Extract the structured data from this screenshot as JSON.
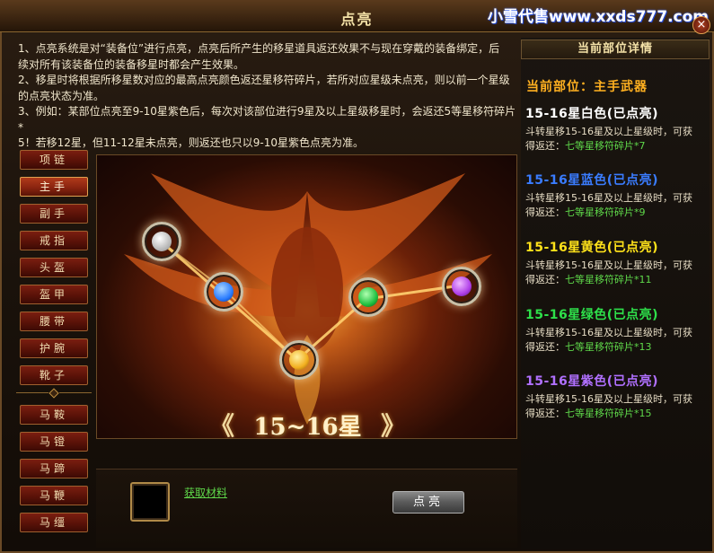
{
  "window": {
    "title": "点亮",
    "watermark": "小雪代售www.xxds777.com",
    "close_glyph": "×"
  },
  "description": [
    "1、点亮系统是对“装备位”进行点亮，点亮后所产生的移星道具返还效果不与现在穿戴的装备绑定，后",
    "续对所有该装备位的装备移星时都会产生效果。",
    "2、移星时将根据所移星数对应的最高点亮颜色返还星移符碎片，若所对应星级未点亮，则以前一个星级",
    "的点亮状态为准。",
    "3、例如：某部位点亮至9-10星紫色后，每次对该部位进行9星及以上星级移星时，会返还5等星移符碎片*",
    "5！若移12星，但11-12星未点亮，则返还也只以9-10星紫色点亮为准。"
  ],
  "nav": {
    "items": [
      {
        "label": "项链",
        "active": false
      },
      {
        "label": "主手",
        "active": true
      },
      {
        "label": "副手",
        "active": false
      },
      {
        "label": "戒指",
        "active": false
      },
      {
        "label": "头盔",
        "active": false
      },
      {
        "label": "盔甲",
        "active": false
      },
      {
        "label": "腰带",
        "active": false
      },
      {
        "label": "护腕",
        "active": false
      },
      {
        "label": "靴子",
        "active": false
      },
      {
        "label": "马鞍",
        "active": false
      },
      {
        "label": "马镫",
        "active": false
      },
      {
        "label": "马蹄",
        "active": false
      },
      {
        "label": "马鞭",
        "active": false
      },
      {
        "label": "马缰",
        "active": false
      }
    ]
  },
  "stage": {
    "star_range_label": "15~16星",
    "prev_glyph": "《",
    "next_glyph": "》",
    "orbs": [
      {
        "name": "white",
        "color": "#f0f0f0"
      },
      {
        "name": "blue",
        "color": "#2a7cff"
      },
      {
        "name": "yellow",
        "color": "#f2b020"
      },
      {
        "name": "green",
        "color": "#1fc040"
      },
      {
        "name": "purple",
        "color": "#b040e8"
      }
    ]
  },
  "bottom": {
    "get_material_link": "获取材料",
    "light_button": "点亮"
  },
  "details": {
    "header": "当前部位详情",
    "current_part": "当前部位：主手武器",
    "tiers": [
      {
        "title": "15-16星白色(已点亮)",
        "color": "#ffffff",
        "desc": "斗转星移15-16星及以上星级时，可获",
        "desc2_prefix": "得返还：",
        "reward": "七等星移符碎片*7"
      },
      {
        "title": "15-16星蓝色(已点亮)",
        "color": "#3a7cff",
        "desc": "斗转星移15-16星及以上星级时，可获",
        "desc2_prefix": "得返还：",
        "reward": "七等星移符碎片*9"
      },
      {
        "title": "15-16星黄色(已点亮)",
        "color": "#ffe21a",
        "desc": "斗转星移15-16星及以上星级时，可获",
        "desc2_prefix": "得返还：",
        "reward": "七等星移符碎片*11"
      },
      {
        "title": "15-16星绿色(已点亮)",
        "color": "#2ee04a",
        "desc": "斗转星移15-16星及以上星级时，可获",
        "desc2_prefix": "得返还：",
        "reward": "七等星移符碎片*13"
      },
      {
        "title": "15-16星紫色(已点亮)",
        "color": "#b070ff",
        "desc": "斗转星移15-16星及以上星级时，可获",
        "desc2_prefix": "得返还：",
        "reward": "七等星移符碎片*15"
      }
    ]
  }
}
